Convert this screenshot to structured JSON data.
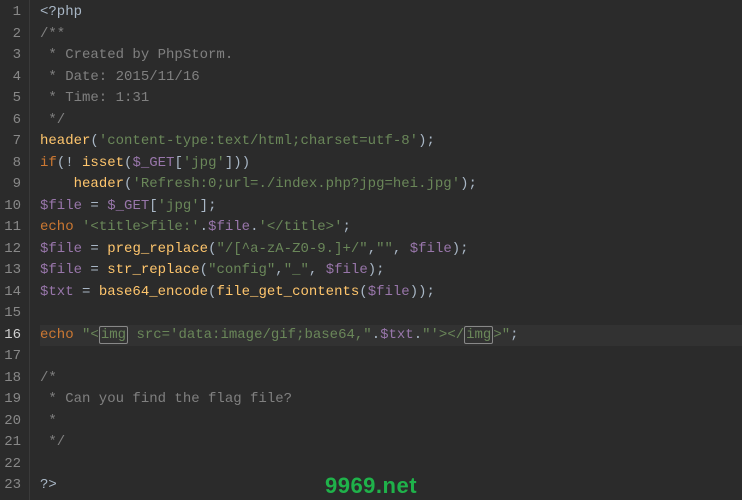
{
  "watermark": "9969.net",
  "gutter": {
    "lines": [
      "1",
      "2",
      "3",
      "4",
      "5",
      "6",
      "7",
      "8",
      "9",
      "10",
      "11",
      "12",
      "13",
      "14",
      "15",
      "16",
      "17",
      "18",
      "19",
      "20",
      "21",
      "22",
      "23"
    ],
    "current_index": 15
  },
  "code": {
    "lines": [
      [
        {
          "cls": "c-fg",
          "t": "<?php"
        }
      ],
      [
        {
          "cls": "c-comment",
          "t": "/**"
        }
      ],
      [
        {
          "cls": "c-comment",
          "t": " * Created by PhpStorm."
        }
      ],
      [
        {
          "cls": "c-comment",
          "t": " * Date: 2015/11/16"
        }
      ],
      [
        {
          "cls": "c-comment",
          "t": " * Time: 1:31"
        }
      ],
      [
        {
          "cls": "c-comment",
          "t": " */"
        }
      ],
      [
        {
          "cls": "c-func",
          "t": "header"
        },
        {
          "cls": "c-punct",
          "t": "("
        },
        {
          "cls": "c-string",
          "t": "'content-type:text/html;charset=utf-8'"
        },
        {
          "cls": "c-punct",
          "t": ");"
        }
      ],
      [
        {
          "cls": "c-keyword",
          "t": "if"
        },
        {
          "cls": "c-punct",
          "t": "(! "
        },
        {
          "cls": "c-func",
          "t": "isset"
        },
        {
          "cls": "c-punct",
          "t": "("
        },
        {
          "cls": "c-var",
          "t": "$_GET"
        },
        {
          "cls": "c-punct",
          "t": "["
        },
        {
          "cls": "c-string",
          "t": "'jpg'"
        },
        {
          "cls": "c-punct",
          "t": "]))"
        }
      ],
      [
        {
          "cls": "c-punct",
          "t": "    "
        },
        {
          "cls": "c-func",
          "t": "header"
        },
        {
          "cls": "c-punct",
          "t": "("
        },
        {
          "cls": "c-string",
          "t": "'Refresh:0;url=./index.php?jpg=hei.jpg'"
        },
        {
          "cls": "c-punct",
          "t": ");"
        }
      ],
      [
        {
          "cls": "c-var",
          "t": "$file"
        },
        {
          "cls": "c-op",
          "t": " = "
        },
        {
          "cls": "c-var",
          "t": "$_GET"
        },
        {
          "cls": "c-punct",
          "t": "["
        },
        {
          "cls": "c-string",
          "t": "'jpg'"
        },
        {
          "cls": "c-punct",
          "t": "];"
        }
      ],
      [
        {
          "cls": "c-keyword",
          "t": "echo"
        },
        {
          "cls": "c-punct",
          "t": " "
        },
        {
          "cls": "c-string",
          "t": "'<title>file:'"
        },
        {
          "cls": "c-op",
          "t": "."
        },
        {
          "cls": "c-var",
          "t": "$file"
        },
        {
          "cls": "c-op",
          "t": "."
        },
        {
          "cls": "c-string",
          "t": "'</title>'"
        },
        {
          "cls": "c-punct",
          "t": ";"
        }
      ],
      [
        {
          "cls": "c-var",
          "t": "$file"
        },
        {
          "cls": "c-op",
          "t": " = "
        },
        {
          "cls": "c-func",
          "t": "preg_replace"
        },
        {
          "cls": "c-punct",
          "t": "("
        },
        {
          "cls": "c-string",
          "t": "\"/[^a-zA-Z0-9.]+/\""
        },
        {
          "cls": "c-punct",
          "t": ","
        },
        {
          "cls": "c-string",
          "t": "\"\""
        },
        {
          "cls": "c-punct",
          "t": ", "
        },
        {
          "cls": "c-var",
          "t": "$file"
        },
        {
          "cls": "c-punct",
          "t": ");"
        }
      ],
      [
        {
          "cls": "c-var",
          "t": "$file"
        },
        {
          "cls": "c-op",
          "t": " = "
        },
        {
          "cls": "c-func",
          "t": "str_replace"
        },
        {
          "cls": "c-punct",
          "t": "("
        },
        {
          "cls": "c-string",
          "t": "\"config\""
        },
        {
          "cls": "c-punct",
          "t": ","
        },
        {
          "cls": "c-string",
          "t": "\"_\""
        },
        {
          "cls": "c-punct",
          "t": ", "
        },
        {
          "cls": "c-var",
          "t": "$file"
        },
        {
          "cls": "c-punct",
          "t": ");"
        }
      ],
      [
        {
          "cls": "c-var",
          "t": "$txt"
        },
        {
          "cls": "c-op",
          "t": " = "
        },
        {
          "cls": "c-func",
          "t": "base64_encode"
        },
        {
          "cls": "c-punct",
          "t": "("
        },
        {
          "cls": "c-func",
          "t": "file_get_contents"
        },
        {
          "cls": "c-punct",
          "t": "("
        },
        {
          "cls": "c-var",
          "t": "$file"
        },
        {
          "cls": "c-punct",
          "t": "));"
        }
      ],
      [],
      [
        {
          "cls": "c-keyword",
          "t": "echo"
        },
        {
          "cls": "c-punct",
          "t": " "
        },
        {
          "cls": "c-string",
          "t": "\"<"
        },
        {
          "cls": "c-string c-tagbox",
          "t": "img"
        },
        {
          "cls": "c-string",
          "t": " src='data:image/gif;base64,\""
        },
        {
          "cls": "c-op",
          "t": "."
        },
        {
          "cls": "c-var",
          "t": "$txt"
        },
        {
          "cls": "c-op",
          "t": "."
        },
        {
          "cls": "c-string",
          "t": "\"'></"
        },
        {
          "cls": "c-string c-tagbox",
          "t": "img"
        },
        {
          "cls": "c-string",
          "t": ">\""
        },
        {
          "cls": "c-punct",
          "t": ";"
        }
      ],
      [],
      [
        {
          "cls": "c-comment",
          "t": "/*"
        }
      ],
      [
        {
          "cls": "c-comment",
          "t": " * Can you find the flag file?"
        }
      ],
      [
        {
          "cls": "c-comment",
          "t": " *"
        }
      ],
      [
        {
          "cls": "c-comment",
          "t": " */"
        }
      ],
      [],
      [
        {
          "cls": "c-fg",
          "t": "?>"
        }
      ]
    ],
    "current_index": 15
  }
}
